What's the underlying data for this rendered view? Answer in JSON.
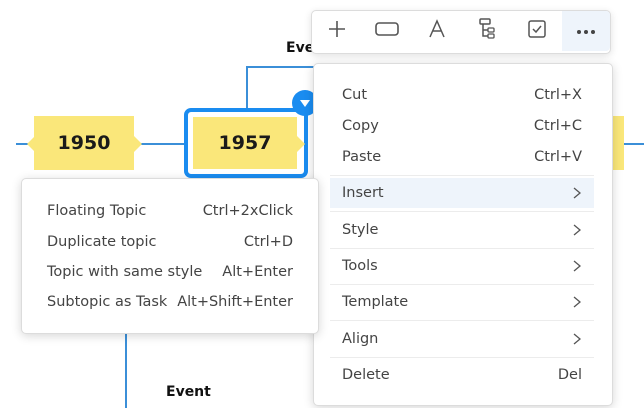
{
  "canvas": {
    "topics": [
      {
        "label": "1950"
      },
      {
        "label": "1957",
        "selected": true
      },
      {
        "label": ""
      }
    ],
    "event_labels": [
      "Event",
      "Event"
    ]
  },
  "toolbar": {
    "buttons": [
      {
        "icon": "plus-icon"
      },
      {
        "icon": "rectangle-shape-icon"
      },
      {
        "icon": "text-style-icon"
      },
      {
        "icon": "structure-icon"
      },
      {
        "icon": "task-checkbox-icon"
      },
      {
        "icon": "more-icon",
        "active": true
      }
    ]
  },
  "context_menu": {
    "items": [
      {
        "label": "Cut",
        "shortcut": "Ctrl+X"
      },
      {
        "label": "Copy",
        "shortcut": "Ctrl+C"
      },
      {
        "label": "Paste",
        "shortcut": "Ctrl+V"
      },
      {
        "label": "Insert",
        "submenu": true,
        "highlighted": true
      },
      {
        "label": "Style",
        "submenu": true
      },
      {
        "label": "Tools",
        "submenu": true
      },
      {
        "label": "Template",
        "submenu": true
      },
      {
        "label": "Align",
        "submenu": true
      },
      {
        "label": "Delete",
        "shortcut": "Del"
      }
    ]
  },
  "insert_submenu": {
    "items": [
      {
        "label": "Floating Topic",
        "shortcut": "Ctrl+2xClick"
      },
      {
        "label": "Duplicate topic",
        "shortcut": "Ctrl+D"
      },
      {
        "label": "Topic with same style",
        "shortcut": "Alt+Enter"
      },
      {
        "label": "Subtopic as Task",
        "shortcut": "Alt+Shift+Enter"
      }
    ]
  },
  "colors": {
    "connector": "#3b8fd8",
    "topic_fill": "#fae77a",
    "selection": "#1a8cf0",
    "menu_highlight": "#eef4fb"
  }
}
